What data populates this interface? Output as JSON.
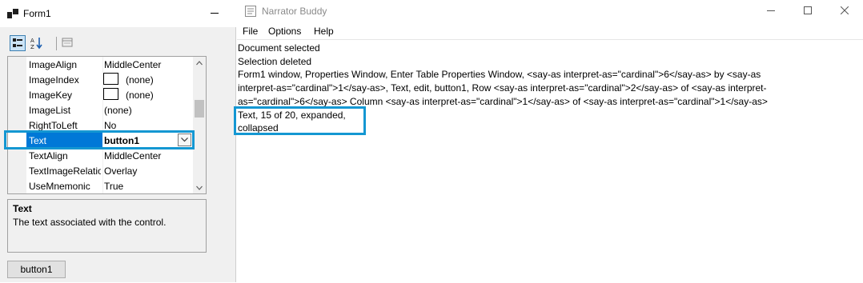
{
  "form1": {
    "title": "Form1",
    "icons": [
      "categorized-icon",
      "alphabetical-icon",
      "property-pages-icon"
    ],
    "properties": [
      {
        "name": "ImageAlign",
        "value": "MiddleCenter"
      },
      {
        "name": "ImageIndex",
        "value": "(none)",
        "swatch": true
      },
      {
        "name": "ImageKey",
        "value": "(none)",
        "swatch": true
      },
      {
        "name": "ImageList",
        "value": "(none)"
      },
      {
        "name": "RightToLeft",
        "value": "No"
      },
      {
        "name": "Text",
        "value": "button1",
        "selected": true
      },
      {
        "name": "TextAlign",
        "value": "MiddleCenter"
      },
      {
        "name": "TextImageRelation",
        "value": "Overlay"
      },
      {
        "name": "UseMnemonic",
        "value": "True"
      }
    ],
    "description": {
      "title": "Text",
      "text": "The text associated with the control."
    },
    "button_label": "button1"
  },
  "narrator": {
    "title": "Narrator Buddy",
    "menu": [
      "File",
      "Options",
      "Help"
    ],
    "log_lines": [
      "Document selected",
      "Selection deleted",
      "Form1 window,  Properties Window, Enter Table Properties Window, <say-as interpret-as=\"cardinal\">6</say-as> by <say-as",
      "interpret-as=\"cardinal\">1</say-as>, Text, edit, button1, Row <say-as interpret-as=\"cardinal\">2</say-as> of <say-as interpret-",
      "as=\"cardinal\">6</say-as> Column <say-as interpret-as=\"cardinal\">1</say-as> of <say-as interpret-as=\"cardinal\">1</say-as>",
      "Text, 15 of 20, expanded,",
      "collapsed"
    ]
  },
  "colors": {
    "selection": "#0078d7",
    "focus_outline": "#1497d2"
  }
}
